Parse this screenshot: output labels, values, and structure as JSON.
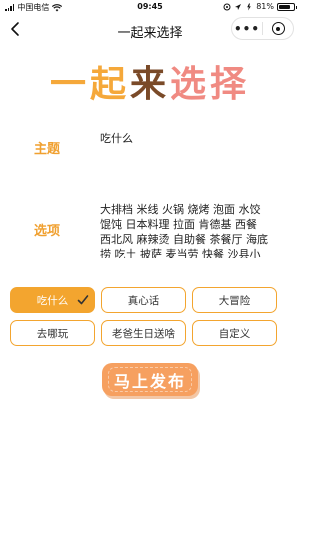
{
  "status_bar": {
    "carrier": "中国电信",
    "time": "09:45",
    "battery_text": "81%",
    "battery_level": 0.81
  },
  "nav": {
    "title": "一起来选择",
    "more_label": "•••"
  },
  "hero": {
    "chars": [
      "一",
      "起",
      "来",
      "选",
      "择"
    ]
  },
  "form": {
    "topic_label": "主题",
    "topic_value": "吃什么",
    "options_label": "选项",
    "options_value": "大排档 米线 火锅 烧烤 泡面 水饺馄饨 日本料理 拉面 肯德基 西餐 西北风 麻辣烫 自助餐 茶餐厅 海底捞 吃土 披萨 麦当劳 快餐 沙县小吃"
  },
  "presets": [
    {
      "label": "吃什么",
      "selected": true
    },
    {
      "label": "真心话",
      "selected": false
    },
    {
      "label": "大冒险",
      "selected": false
    },
    {
      "label": "去哪玩",
      "selected": false
    },
    {
      "label": "老爸生日送啥",
      "selected": false
    },
    {
      "label": "自定义",
      "selected": false
    }
  ],
  "publish_label": "马上发布",
  "colors": {
    "accent": "#f3a52f",
    "publish": "#f6a060",
    "title_brown": "#7a4a28",
    "title_pink": "#f08a82"
  }
}
